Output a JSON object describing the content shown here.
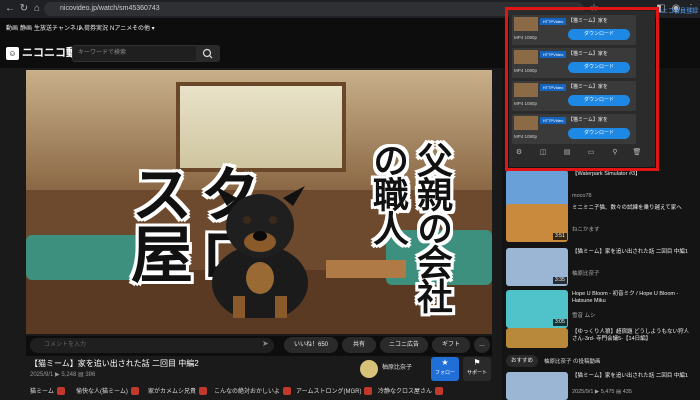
{
  "browser": {
    "url": "nicovideo.jp/watch/sm45360743"
  },
  "site_nav": {
    "items": [
      "動画",
      "静画",
      "生放送",
      "チャンネル",
      "入荷券",
      "実況",
      "Nアニメ",
      "その他 ▾"
    ],
    "right_link": "ニコニコ会員登録"
  },
  "header": {
    "logo_text": "ニコニコ動画",
    "search_placeholder": "キーワードで検索"
  },
  "video": {
    "overlay_left": "クロス屋",
    "overlay_right": "父親の会社の職人"
  },
  "comment_bar": {
    "placeholder": "コメントを入力",
    "like_label": "いいね！650",
    "share_label": "共有",
    "ad_label": "ニコニ広告",
    "gift_label": "ギフト",
    "more_label": "…"
  },
  "info": {
    "title": "【猫ミーム】家を追い出された話 二回目 中編2",
    "date": "2025/9/1",
    "views": "5,248",
    "comments": "396",
    "uploader": "柚原比奈子",
    "follow_label": "フォロー",
    "support_label": "サポート",
    "tags": [
      "猫ミーム",
      "愉快な人(猫ミーム)",
      "家がカメムシ兄貴",
      "こんなの絶対おかしいよ",
      "アームストロング(MGR)",
      "冷静なクロス屋さん"
    ]
  },
  "sidebar": {
    "items": [
      {
        "title": "【Waterpark Simulator #3】",
        "channel": "moco78",
        "duration": "",
        "color": "#6aa0d8"
      },
      {
        "title": "ミニミニ子猫、数々の試練を乗り越えて家へ",
        "channel": "ねこかます",
        "duration": "3:51",
        "color": "#c98a3e"
      },
      {
        "title": "【猫ミーム】家を追い出された話 二回目 中編1",
        "channel": "柚原比奈子",
        "duration": "3:35",
        "color": "#9bb5d4"
      },
      {
        "title": "Hope U Bloom - 初音ミク / Hope U Bloom - Hatsune Miku",
        "channel": "雪音 ムシ",
        "duration": "3:05",
        "color": "#4fc3c9"
      },
      {
        "title": "【ゆっくり人狼】超宿題 どうしようもない狩人さん-3rd- 寺門会議5-【14日編】",
        "channel": "",
        "duration": "",
        "color": "#b8893a"
      }
    ],
    "recommend_label": "おすすめ",
    "recommend_channel": "柚原比奈子 の投稿動画",
    "bottom_item": {
      "title": "【猫ミーム】家を追い出された話 二回目 中編1",
      "meta": "2025/9/1  ▶ 5,475  ▤ 435"
    }
  },
  "extension_popup": {
    "rows": [
      {
        "title": "【猫ミーム】家を",
        "format": "MP4  1080p",
        "badge": "HTTPVideo"
      },
      {
        "title": "【猫ミーム】家を",
        "format": "MP4  1080p",
        "badge": "HTTPVideo"
      },
      {
        "title": "【猫ミーム】家を",
        "format": "MP4  1080p",
        "badge": "HTTPVideo"
      },
      {
        "title": "【猫ミーム】家を",
        "format": "MP4  1080p",
        "badge": "HTTPVideo"
      }
    ],
    "download_label": "ダウンロード"
  }
}
